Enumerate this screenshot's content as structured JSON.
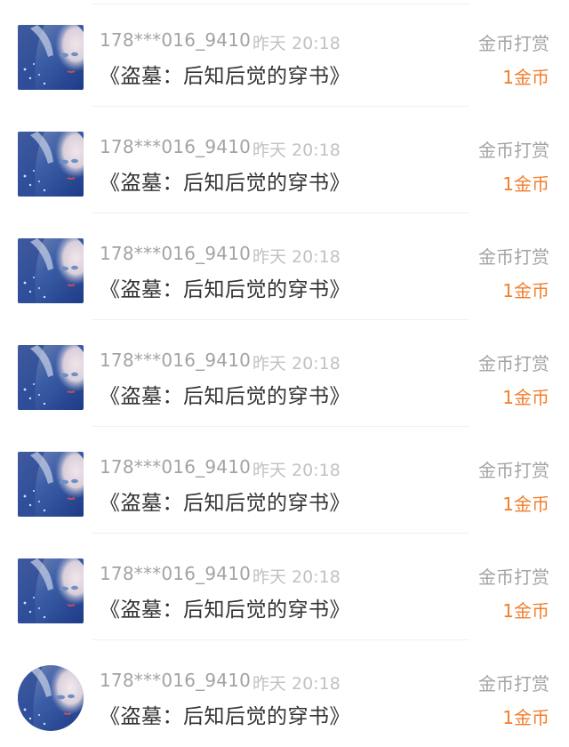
{
  "rewards": [
    {
      "user": "178***016_9410",
      "time": "昨天 20:18",
      "book": "《盗墓：后知后觉的穿书》",
      "type": "金币打赏",
      "amount": "1金币"
    },
    {
      "user": "178***016_9410",
      "time": "昨天 20:18",
      "book": "《盗墓：后知后觉的穿书》",
      "type": "金币打赏",
      "amount": "1金币"
    },
    {
      "user": "178***016_9410",
      "time": "昨天 20:18",
      "book": "《盗墓：后知后觉的穿书》",
      "type": "金币打赏",
      "amount": "1金币"
    },
    {
      "user": "178***016_9410",
      "time": "昨天 20:18",
      "book": "《盗墓：后知后觉的穿书》",
      "type": "金币打赏",
      "amount": "1金币"
    },
    {
      "user": "178***016_9410",
      "time": "昨天 20:18",
      "book": "《盗墓：后知后觉的穿书》",
      "type": "金币打赏",
      "amount": "1金币"
    },
    {
      "user": "178***016_9410",
      "time": "昨天 20:18",
      "book": "《盗墓：后知后觉的穿书》",
      "type": "金币打赏",
      "amount": "1金币"
    },
    {
      "user": "178***016_9410",
      "time": "昨天 20:18",
      "book": "《盗墓：后知后觉的穿书》",
      "type": "金币打赏",
      "amount": "1金币"
    }
  ],
  "colors": {
    "accent": "#f27e2b",
    "muted_text": "#a3a3a3",
    "time_text": "#c2c2c2",
    "primary_text": "#333333",
    "divider": "#f0f0f0"
  },
  "icons": {
    "avatar": "user-avatar-icon"
  }
}
